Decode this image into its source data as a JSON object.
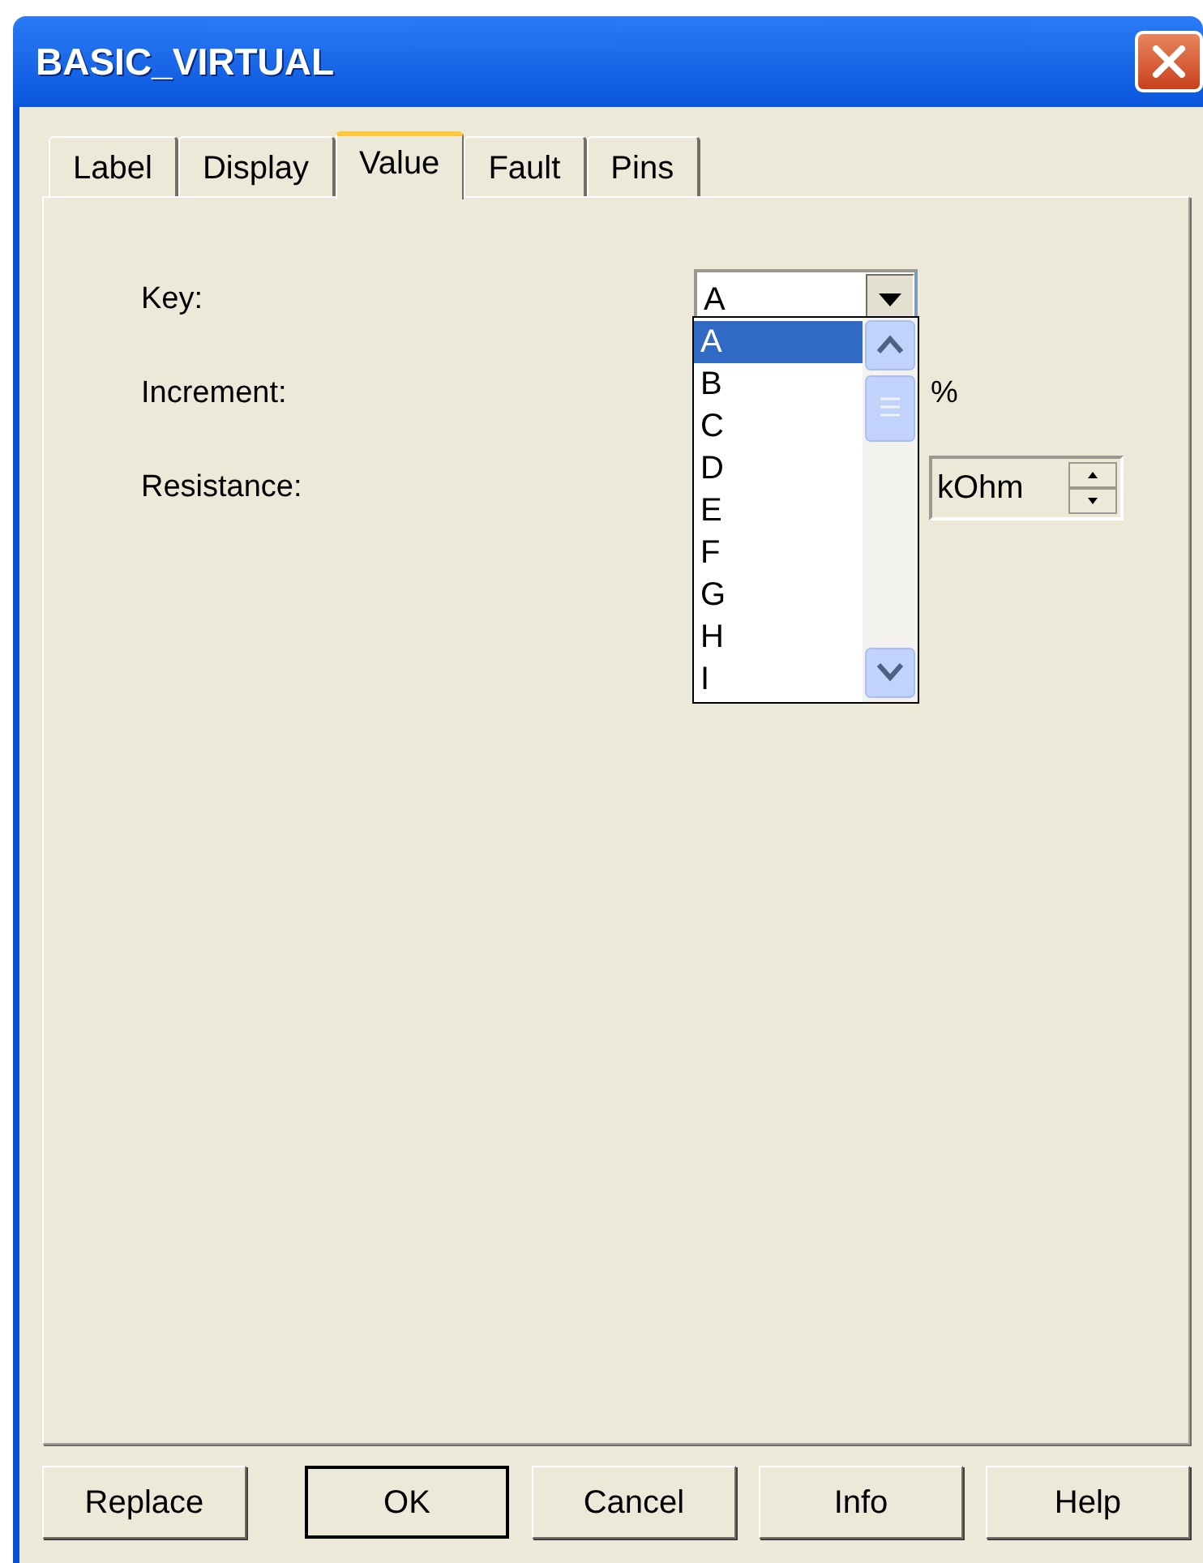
{
  "window": {
    "title": "BASIC_VIRTUAL"
  },
  "tabs": [
    {
      "label": "Label",
      "selected": false
    },
    {
      "label": "Display",
      "selected": false
    },
    {
      "label": "Value",
      "selected": true
    },
    {
      "label": "Fault",
      "selected": false
    },
    {
      "label": "Pins",
      "selected": false
    }
  ],
  "rows": [
    {
      "kind": "combo",
      "label": "Key:",
      "value": "A",
      "expanded": true
    },
    {
      "kind": "unit",
      "label": "Increment:",
      "unit": "%"
    },
    {
      "kind": "unit_spin",
      "label": "Resistance:",
      "unit": "kOhm"
    }
  ],
  "dropdown": {
    "items": [
      {
        "label": "A",
        "selected": true
      },
      {
        "label": "B",
        "selected": false
      },
      {
        "label": "C",
        "selected": false
      },
      {
        "label": "D",
        "selected": false
      },
      {
        "label": "E",
        "selected": false
      },
      {
        "label": "F",
        "selected": false
      },
      {
        "label": "G",
        "selected": false
      },
      {
        "label": "H",
        "selected": false
      },
      {
        "label": "I",
        "selected": false
      }
    ]
  },
  "buttons": [
    {
      "label": "Replace",
      "default": false
    },
    {
      "label": "OK",
      "default": true
    },
    {
      "label": "Cancel",
      "default": false
    },
    {
      "label": "Info",
      "default": false
    },
    {
      "label": "Help",
      "default": false
    }
  ]
}
